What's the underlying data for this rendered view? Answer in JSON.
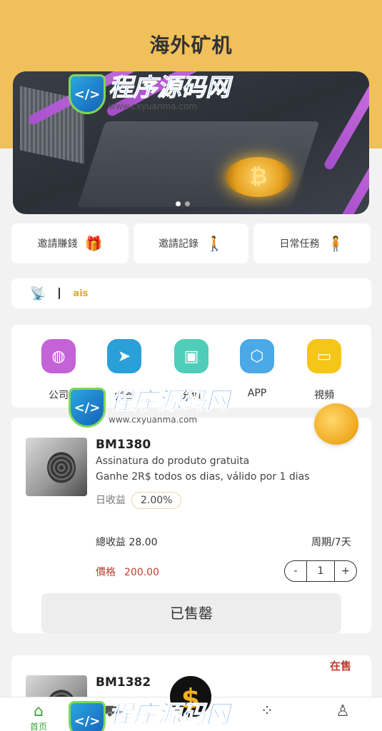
{
  "header": {
    "title": "海外矿机"
  },
  "banner": {
    "coin_symbol": "₿",
    "slides": 2,
    "active_slide": 0
  },
  "watermark": {
    "text": "程序源码网",
    "url": "www.cxyuanma.com",
    "shield": "</>"
  },
  "quick_links": [
    {
      "label": "邀請賺錢",
      "icon": "gift-icon",
      "glyph": "🎁"
    },
    {
      "label": "邀請記錄",
      "icon": "person-icon",
      "glyph": "🚶"
    },
    {
      "label": "日常任務",
      "icon": "person-icon",
      "glyph": "🧍"
    }
  ],
  "notice": {
    "text": "ais"
  },
  "menu": [
    {
      "label": "公司",
      "icon": "globe-icon",
      "glyph": "◍",
      "color": "#c462d8"
    },
    {
      "label": "問答",
      "icon": "telegram-icon",
      "glyph": "➤",
      "color": "#2a9fd8"
    },
    {
      "label": "充值",
      "icon": "wallet-icon",
      "glyph": "▣",
      "color": "#4fcdb9"
    },
    {
      "label": "APP",
      "icon": "cube-icon",
      "glyph": "⬡",
      "color": "#4aa9e6"
    },
    {
      "label": "視頻",
      "icon": "video-icon",
      "glyph": "▭",
      "color": "#f5c518"
    }
  ],
  "products": [
    {
      "name": "BM1380",
      "desc1": "Assinatura do produto gratuita",
      "desc2": "Ganhe 2R$ todos os dias, válido por 1 dias",
      "daily_label": "日收益",
      "daily_rate": "2.00%",
      "total_label": "總收益",
      "total_value": "28.00",
      "period": "周期/7天",
      "price_label": "價格",
      "price_value": "200.00",
      "qty": "1",
      "minus": "-",
      "plus": "+",
      "button": "已售罄"
    },
    {
      "name": "BM1382",
      "status": "在售"
    }
  ],
  "tabbar": {
    "tabs": [
      {
        "label": "首页",
        "icon": "home-icon",
        "glyph": "⌂"
      },
      {
        "label": "",
        "icon": "cart-icon",
        "glyph": "⛟"
      },
      {
        "label": "",
        "icon": "dots-icon",
        "glyph": "⁘"
      },
      {
        "label": "",
        "icon": "user-icon",
        "glyph": "♙"
      }
    ],
    "center": "$"
  }
}
